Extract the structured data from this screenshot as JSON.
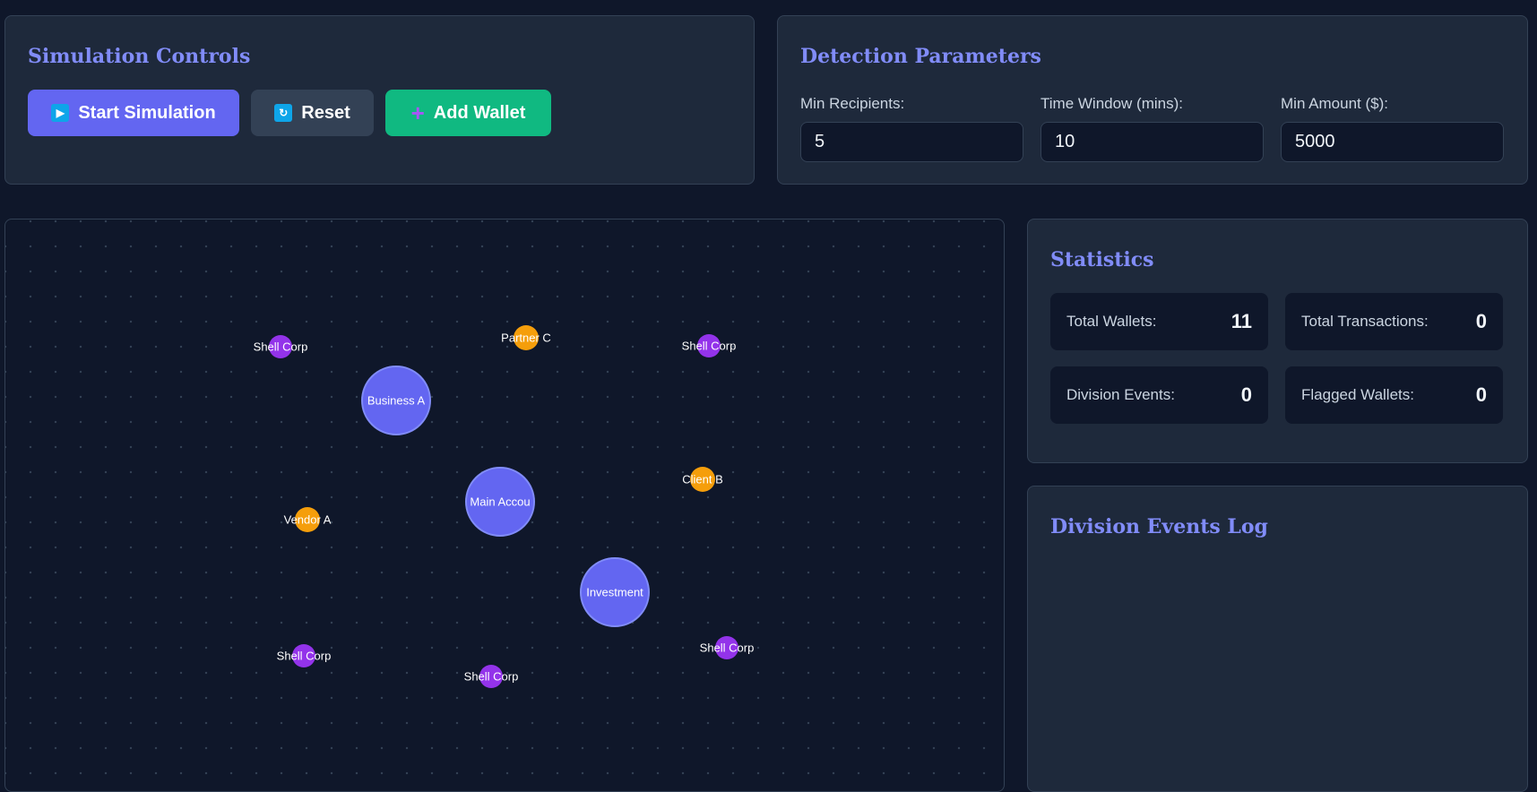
{
  "controls": {
    "title": "Simulation Controls",
    "start_label": "Start Simulation",
    "reset_label": "Reset",
    "add_label": "Add Wallet"
  },
  "params": {
    "title": "Detection Parameters",
    "min_recipients_label": "Min Recipients:",
    "min_recipients_value": "5",
    "time_window_label": "Time Window (mins):",
    "time_window_value": "10",
    "min_amount_label": "Min Amount ($):",
    "min_amount_value": "5000"
  },
  "network": {
    "nodes": [
      {
        "label": "Shell Corp"
      },
      {
        "label": "Partner C"
      },
      {
        "label": "Shell Corp"
      },
      {
        "label": "Business A"
      },
      {
        "label": "Client B"
      },
      {
        "label": "Main Accou"
      },
      {
        "label": "Vendor A"
      },
      {
        "label": "Investment"
      },
      {
        "label": "Shell Corp"
      },
      {
        "label": "Shell Corp"
      },
      {
        "label": "Shell Corp"
      }
    ]
  },
  "stats": {
    "title": "Statistics",
    "total_wallets_label": "Total Wallets:",
    "total_wallets_value": "11",
    "total_transactions_label": "Total Transactions:",
    "total_transactions_value": "0",
    "division_events_label": "Division Events:",
    "division_events_value": "0",
    "flagged_wallets_label": "Flagged Wallets:",
    "flagged_wallets_value": "0"
  },
  "log": {
    "title": "Division Events Log"
  },
  "colors": {
    "accent": "#6366f1",
    "title": "#818cf8",
    "success": "#10b981",
    "shell_node": "#9333ea",
    "external_node": "#f59e0b",
    "background": "#0f172a",
    "panel": "#1e293b"
  }
}
